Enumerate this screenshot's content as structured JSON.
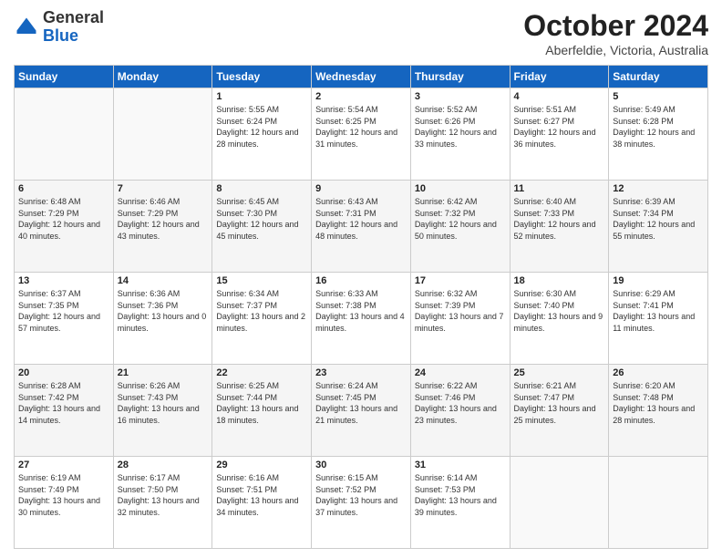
{
  "header": {
    "logo_general": "General",
    "logo_blue": "Blue",
    "month": "October 2024",
    "location": "Aberfeldie, Victoria, Australia"
  },
  "weekdays": [
    "Sunday",
    "Monday",
    "Tuesday",
    "Wednesday",
    "Thursday",
    "Friday",
    "Saturday"
  ],
  "weeks": [
    [
      {
        "day": "",
        "info": ""
      },
      {
        "day": "",
        "info": ""
      },
      {
        "day": "1",
        "info": "Sunrise: 5:55 AM\nSunset: 6:24 PM\nDaylight: 12 hours and 28 minutes."
      },
      {
        "day": "2",
        "info": "Sunrise: 5:54 AM\nSunset: 6:25 PM\nDaylight: 12 hours and 31 minutes."
      },
      {
        "day": "3",
        "info": "Sunrise: 5:52 AM\nSunset: 6:26 PM\nDaylight: 12 hours and 33 minutes."
      },
      {
        "day": "4",
        "info": "Sunrise: 5:51 AM\nSunset: 6:27 PM\nDaylight: 12 hours and 36 minutes."
      },
      {
        "day": "5",
        "info": "Sunrise: 5:49 AM\nSunset: 6:28 PM\nDaylight: 12 hours and 38 minutes."
      }
    ],
    [
      {
        "day": "6",
        "info": "Sunrise: 6:48 AM\nSunset: 7:29 PM\nDaylight: 12 hours and 40 minutes."
      },
      {
        "day": "7",
        "info": "Sunrise: 6:46 AM\nSunset: 7:29 PM\nDaylight: 12 hours and 43 minutes."
      },
      {
        "day": "8",
        "info": "Sunrise: 6:45 AM\nSunset: 7:30 PM\nDaylight: 12 hours and 45 minutes."
      },
      {
        "day": "9",
        "info": "Sunrise: 6:43 AM\nSunset: 7:31 PM\nDaylight: 12 hours and 48 minutes."
      },
      {
        "day": "10",
        "info": "Sunrise: 6:42 AM\nSunset: 7:32 PM\nDaylight: 12 hours and 50 minutes."
      },
      {
        "day": "11",
        "info": "Sunrise: 6:40 AM\nSunset: 7:33 PM\nDaylight: 12 hours and 52 minutes."
      },
      {
        "day": "12",
        "info": "Sunrise: 6:39 AM\nSunset: 7:34 PM\nDaylight: 12 hours and 55 minutes."
      }
    ],
    [
      {
        "day": "13",
        "info": "Sunrise: 6:37 AM\nSunset: 7:35 PM\nDaylight: 12 hours and 57 minutes."
      },
      {
        "day": "14",
        "info": "Sunrise: 6:36 AM\nSunset: 7:36 PM\nDaylight: 13 hours and 0 minutes."
      },
      {
        "day": "15",
        "info": "Sunrise: 6:34 AM\nSunset: 7:37 PM\nDaylight: 13 hours and 2 minutes."
      },
      {
        "day": "16",
        "info": "Sunrise: 6:33 AM\nSunset: 7:38 PM\nDaylight: 13 hours and 4 minutes."
      },
      {
        "day": "17",
        "info": "Sunrise: 6:32 AM\nSunset: 7:39 PM\nDaylight: 13 hours and 7 minutes."
      },
      {
        "day": "18",
        "info": "Sunrise: 6:30 AM\nSunset: 7:40 PM\nDaylight: 13 hours and 9 minutes."
      },
      {
        "day": "19",
        "info": "Sunrise: 6:29 AM\nSunset: 7:41 PM\nDaylight: 13 hours and 11 minutes."
      }
    ],
    [
      {
        "day": "20",
        "info": "Sunrise: 6:28 AM\nSunset: 7:42 PM\nDaylight: 13 hours and 14 minutes."
      },
      {
        "day": "21",
        "info": "Sunrise: 6:26 AM\nSunset: 7:43 PM\nDaylight: 13 hours and 16 minutes."
      },
      {
        "day": "22",
        "info": "Sunrise: 6:25 AM\nSunset: 7:44 PM\nDaylight: 13 hours and 18 minutes."
      },
      {
        "day": "23",
        "info": "Sunrise: 6:24 AM\nSunset: 7:45 PM\nDaylight: 13 hours and 21 minutes."
      },
      {
        "day": "24",
        "info": "Sunrise: 6:22 AM\nSunset: 7:46 PM\nDaylight: 13 hours and 23 minutes."
      },
      {
        "day": "25",
        "info": "Sunrise: 6:21 AM\nSunset: 7:47 PM\nDaylight: 13 hours and 25 minutes."
      },
      {
        "day": "26",
        "info": "Sunrise: 6:20 AM\nSunset: 7:48 PM\nDaylight: 13 hours and 28 minutes."
      }
    ],
    [
      {
        "day": "27",
        "info": "Sunrise: 6:19 AM\nSunset: 7:49 PM\nDaylight: 13 hours and 30 minutes."
      },
      {
        "day": "28",
        "info": "Sunrise: 6:17 AM\nSunset: 7:50 PM\nDaylight: 13 hours and 32 minutes."
      },
      {
        "day": "29",
        "info": "Sunrise: 6:16 AM\nSunset: 7:51 PM\nDaylight: 13 hours and 34 minutes."
      },
      {
        "day": "30",
        "info": "Sunrise: 6:15 AM\nSunset: 7:52 PM\nDaylight: 13 hours and 37 minutes."
      },
      {
        "day": "31",
        "info": "Sunrise: 6:14 AM\nSunset: 7:53 PM\nDaylight: 13 hours and 39 minutes."
      },
      {
        "day": "",
        "info": ""
      },
      {
        "day": "",
        "info": ""
      }
    ]
  ]
}
